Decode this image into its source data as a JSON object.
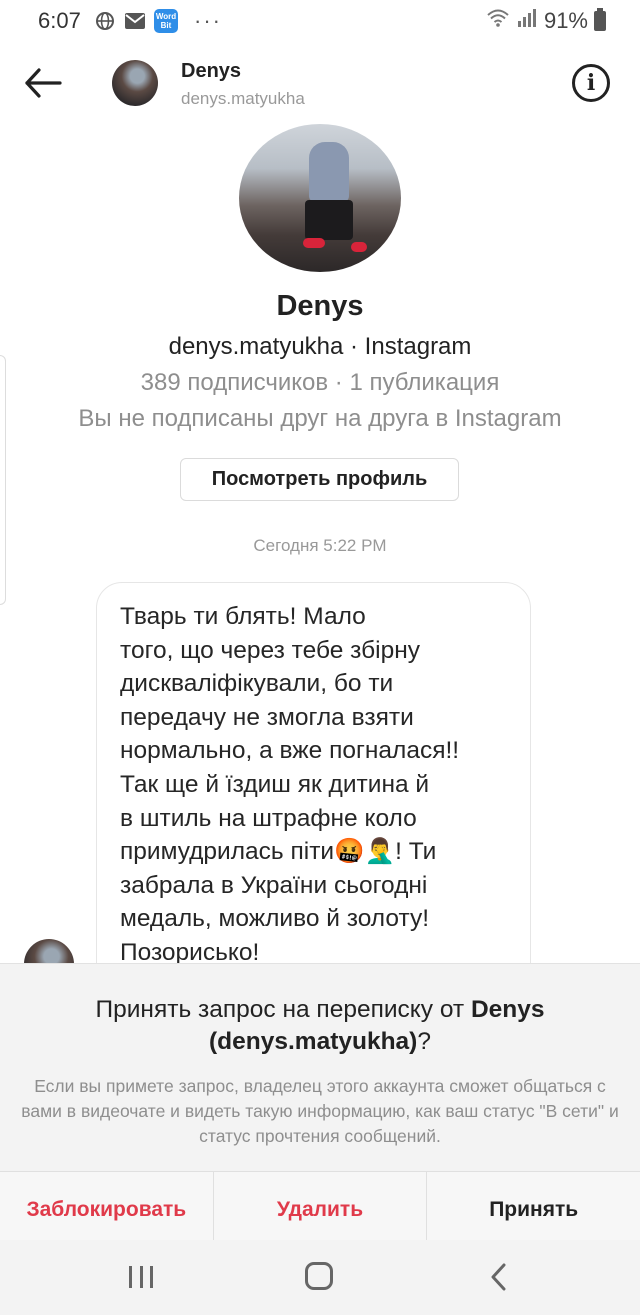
{
  "status_bar": {
    "time": "6:07",
    "wordbit_label": "Word Bit",
    "dots": "···",
    "battery": "91%"
  },
  "header": {
    "name": "Denys",
    "username": "denys.matyukha",
    "info_glyph": "i"
  },
  "profile": {
    "name": "Denys",
    "line1": "denys.matyukha · Instagram",
    "line2": "389 подписчиков · 1 публикация",
    "line3": "Вы не подписаны друг на друга в Instagram",
    "view_profile_label": "Посмотреть профиль"
  },
  "timestamp": "Сегодня 5:22 PM",
  "message": {
    "text": "Тварь ти блять! Мало\nтого, що через тебе збірну\nдискваліфікували, бо ти\nпередачу не змогла взяти\nнормально, а вже погналася!!\nТак ще й їздиш як дитина й\nв штиль на штрафне коло\nпримудрилась піти🤬🤦‍♂️! Ти\nзабрала в України сьогодні\nмедаль, можливо й золоту!\nПозорисько!"
  },
  "request": {
    "title_prefix": "Принять запрос на переписку от ",
    "title_name": "Denys",
    "title_username": "(denys.matyukha)",
    "title_suffix": "?",
    "description": "Если вы примете запрос, владелец этого аккаунта сможет общаться с вами в видеочате и видеть такую информацию, как ваш статус \"В сети\" и статус прочтения сообщений.",
    "block_label": "Заблокировать",
    "delete_label": "Удалить",
    "accept_label": "Принять"
  },
  "colors": {
    "danger": "#e03a4a",
    "muted": "#8e8e8e",
    "sheet_bg": "#f3f3f3"
  },
  "icons": [
    "globe-icon",
    "mail-icon",
    "wordbit-app-icon",
    "wifi-icon",
    "signal-icon",
    "battery-icon",
    "back-arrow-icon",
    "info-icon",
    "recent-apps-icon",
    "home-icon",
    "nav-back-icon"
  ]
}
